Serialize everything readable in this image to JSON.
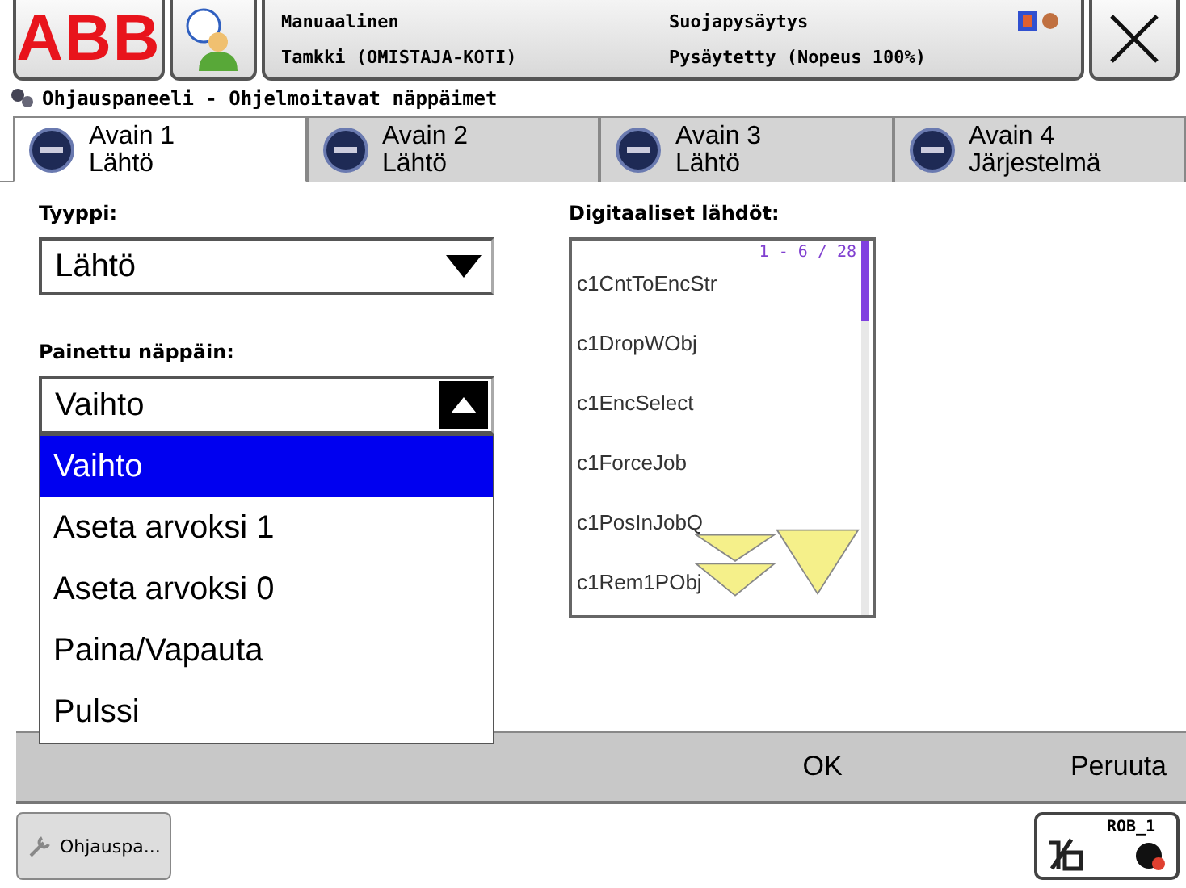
{
  "header": {
    "logo": "ABB",
    "mode": "Manuaalinen",
    "controller": "Tamkki (OMISTAJA-KOTI)",
    "safety": "Suojapysäytys",
    "state": "Pysäytetty (Nopeus 100%)"
  },
  "title": "Ohjauspaneeli - Ohjelmoitavat näppäimet",
  "tabs": [
    {
      "label": "Avain 1",
      "sub": "Lähtö",
      "selected": true
    },
    {
      "label": "Avain 2",
      "sub": "Lähtö",
      "selected": false
    },
    {
      "label": "Avain 3",
      "sub": "Lähtö",
      "selected": false
    },
    {
      "label": "Avain 4",
      "sub": "Järjestelmä",
      "selected": false
    }
  ],
  "type_field": {
    "label": "Tyyppi:",
    "value": "Lähtö"
  },
  "pressed_field": {
    "label": "Painettu näppäin:",
    "value": "Vaihto",
    "expanded": true,
    "options": [
      {
        "label": "Vaihto",
        "selected": true
      },
      {
        "label": "Aseta arvoksi 1",
        "selected": false
      },
      {
        "label": "Aseta arvoksi 0",
        "selected": false
      },
      {
        "label": "Paina/Vapauta",
        "selected": false
      },
      {
        "label": "Pulssi",
        "selected": false
      }
    ]
  },
  "outputs": {
    "label": "Digitaaliset lähdöt:",
    "range": "1 - 6 / 28",
    "items": [
      "c1CntToEncStr",
      "c1DropWObj",
      "c1EncSelect",
      "c1ForceJob",
      "c1PosInJobQ",
      "c1Rem1PObj"
    ]
  },
  "commands": [
    "OK",
    "Peruuta"
  ],
  "taskbar": {
    "app": "Ohjauspa...",
    "task": "ROB_1"
  }
}
